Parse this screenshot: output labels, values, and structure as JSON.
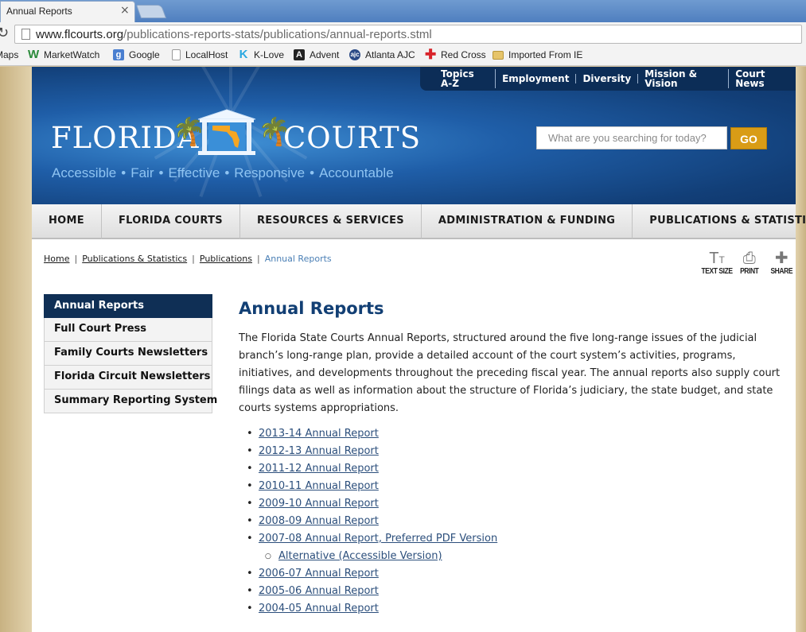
{
  "browser": {
    "tab_title": "Annual Reports",
    "tab_close": "×",
    "url_host": "www.flcourts.org",
    "url_path": "/publications-reports-stats/publications/annual-reports.stml",
    "bookmarks": [
      {
        "label": "Maps",
        "icon": "maps-icon",
        "color": "#ffffff"
      },
      {
        "label": "MarketWatch",
        "icon": "marketwatch-icon",
        "color": "#2a8a3a"
      },
      {
        "label": "Google",
        "icon": "google-icon",
        "color": "#4a7fd0"
      },
      {
        "label": "LocalHost",
        "icon": "page-icon",
        "color": "#ffffff"
      },
      {
        "label": "K-Love",
        "icon": "klove-icon",
        "color": "#2aa8e0"
      },
      {
        "label": "Advent",
        "icon": "advent-icon",
        "color": "#222222"
      },
      {
        "label": "Atlanta AJC",
        "icon": "ajc-icon",
        "color": "#2b4a86"
      },
      {
        "label": "Red Cross",
        "icon": "red-cross-icon",
        "color": "#d8232a"
      },
      {
        "label": "Imported From IE",
        "icon": "folder-icon",
        "color": "#e6c46a"
      }
    ]
  },
  "site": {
    "top_nav": [
      "Topics A-Z",
      "Employment",
      "Diversity",
      "Mission & Vision",
      "Court News"
    ],
    "logo_left": "FLORIDA",
    "logo_right": "COURTS",
    "tagline": [
      "Accessible",
      "Fair",
      "Effective",
      "Responsive",
      "Accountable"
    ],
    "search_placeholder": "What are you searching for today?",
    "search_button": "GO",
    "main_nav": [
      "HOME",
      "FLORIDA COURTS",
      "RESOURCES & SERVICES",
      "ADMINISTRATION & FUNDING",
      "PUBLICATIONS & STATISTICS"
    ],
    "breadcrumb": {
      "home": "Home",
      "pub_stats": "Publications & Statistics",
      "publications": "Publications",
      "current": "Annual Reports"
    },
    "tools": {
      "text_size": "TEXT SIZE",
      "print": "PRINT",
      "share": "SHARE"
    },
    "side_nav": [
      "Annual Reports",
      "Full Court Press",
      "Family Courts Newsletters",
      "Florida Circuit Newsletters",
      "Summary Reporting System"
    ],
    "page_title": "Annual Reports",
    "intro": "The Florida State Courts Annual Reports, structured around the five long-range issues of the judicial branch’s long-range plan, provide a detailed account of the court system’s activities, programs, initiatives, and developments throughout the preceding fiscal year. The annual reports also supply court filings data as well as information about the structure of Florida’s judiciary, the state budget, and state courts systems appropriations.",
    "reports": [
      "2013-14 Annual Report",
      "2012-13 Annual Report",
      "2011-12 Annual Report",
      "2010-11 Annual Report",
      "2009-10 Annual Report",
      "2008-09 Annual Report",
      "2007-08 Annual Report, Preferred PDF Version",
      "Alternative (Accessible Version)",
      "2006-07 Annual Report",
      "2005-06 Annual Report",
      "2004-05 Annual Report"
    ]
  }
}
